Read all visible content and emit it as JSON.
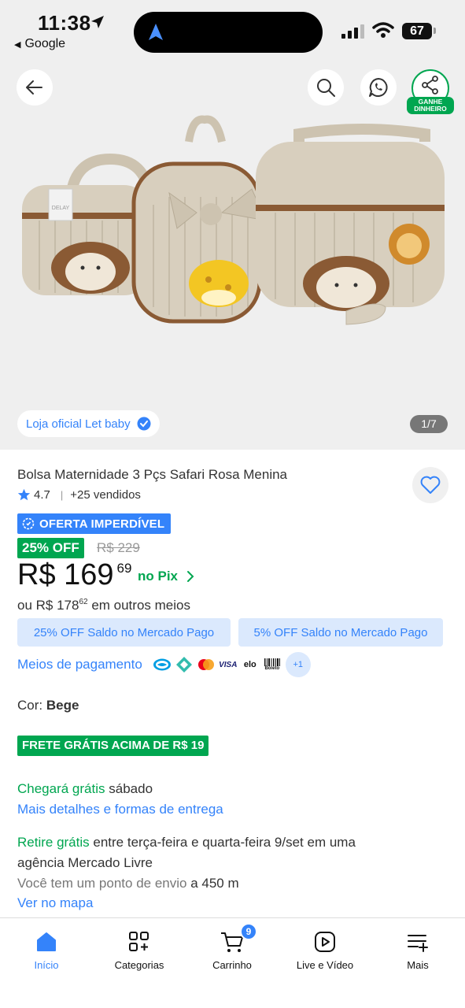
{
  "status_bar": {
    "time": "11:38",
    "back_app": "Google",
    "battery": "67"
  },
  "gallery": {
    "store_label": "Loja oficial Let baby",
    "counter": "1/7",
    "share_label_line1": "GANHE",
    "share_label_line2": "DINHEIRO",
    "hang_tag": "DELAY"
  },
  "product": {
    "title": "Bolsa Maternidade 3 Pçs Safari Rosa Menina",
    "rating": "4.7",
    "sold": "+25 vendidos",
    "deal_badge": "OFERTA IMPERDÍVEL",
    "discount": "25% OFF",
    "old_price": "R$ 229",
    "price_main": "R$ 169",
    "price_cents": "69",
    "pix_label": "no Pix",
    "other_price_prefix": "ou R$ 178",
    "other_price_cents": "62",
    "other_price_suffix": "em outros meios",
    "promos": [
      "25% OFF Saldo no Mercado Pago",
      "5% OFF Saldo no Mercado Pago"
    ],
    "payment_link": "Meios de pagamento",
    "payment_icons": [
      "mercado-pago-icon",
      "pix-icon",
      "mastercard-icon",
      "visa-icon",
      "elo-icon",
      "boleto-icon"
    ],
    "payment_icon_labels": {
      "visa": "VISA",
      "elo": "elo",
      "boleto": "Boleto"
    },
    "payment_more": "+1",
    "color_label": "Cor:",
    "color_value": "Bege",
    "shipping_badge": "FRETE GRÁTIS ACIMA DE R$ 19",
    "delivery_green": "Chegará grátis",
    "delivery_day": "sábado",
    "delivery_link": "Mais detalhes e formas de entrega",
    "pickup_green": "Retire grátis",
    "pickup_text_1": "entre terça-feira e quarta-feira 9/set em uma",
    "pickup_text_2": "agência Mercado Livre",
    "distance_muted": "Você tem um ponto de envio",
    "distance_value": "a 450 m",
    "map_link": "Ver no mapa"
  },
  "bottom_nav": {
    "items": [
      {
        "label": "Início",
        "icon": "home-icon",
        "active": true
      },
      {
        "label": "Categorias",
        "icon": "categories-icon"
      },
      {
        "label": "Carrinho",
        "icon": "cart-icon",
        "badge": "9"
      },
      {
        "label": "Live e Vídeo",
        "icon": "play-icon"
      },
      {
        "label": "Mais",
        "icon": "menu-plus-icon"
      }
    ]
  },
  "colors": {
    "accent_blue": "#3483fa",
    "green": "#00a650",
    "promo_bg": "#dbe9fd",
    "gallery_bg": "#efefef"
  }
}
